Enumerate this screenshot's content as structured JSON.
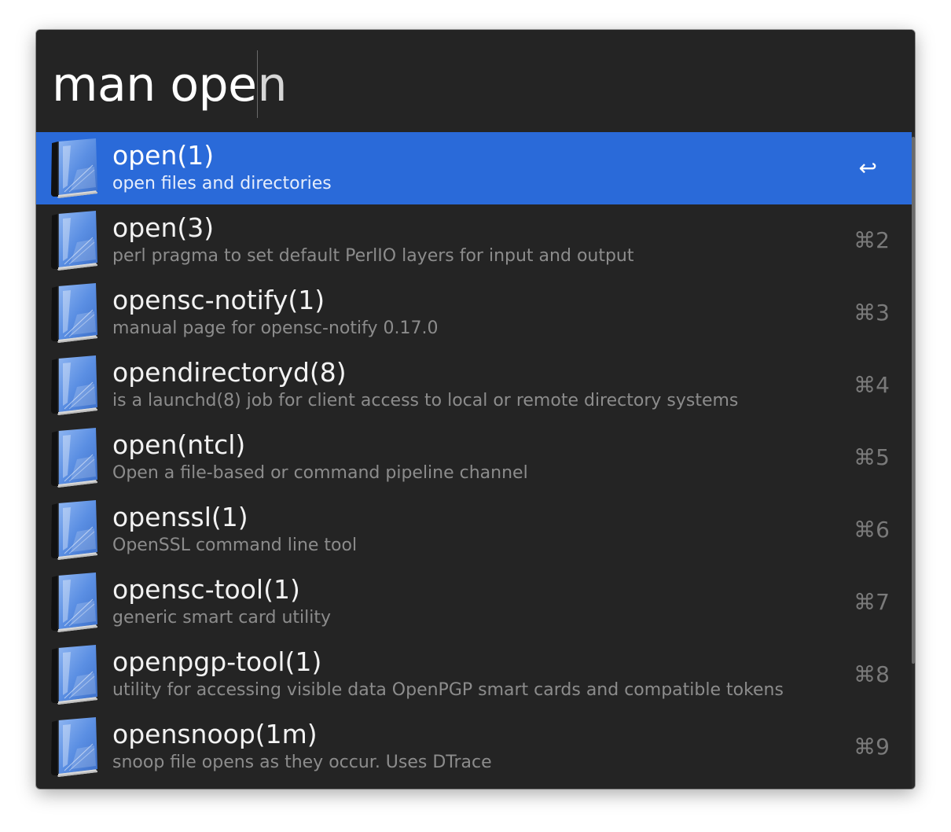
{
  "search": {
    "typed": "man ope",
    "completion": "n"
  },
  "results": [
    {
      "title": "open(1)",
      "subtitle": "open files and directories",
      "shortcut": "↩",
      "icon": "book-icon",
      "selected": true
    },
    {
      "title": "open(3)",
      "subtitle": "perl pragma to set default PerlIO layers for input and output",
      "shortcut": "⌘2",
      "icon": "book-icon"
    },
    {
      "title": "opensc-notify(1)",
      "subtitle": "manual page for opensc-notify 0.17.0",
      "shortcut": "⌘3",
      "icon": "book-icon"
    },
    {
      "title": "opendirectoryd(8)",
      "subtitle": "is a launchd(8) job for client access to local or remote directory systems",
      "shortcut": "⌘4",
      "icon": "book-icon"
    },
    {
      "title": "open(ntcl)",
      "subtitle": "Open a file-based or command pipeline channel",
      "shortcut": "⌘5",
      "icon": "book-icon"
    },
    {
      "title": "openssl(1)",
      "subtitle": "OpenSSL command line tool",
      "shortcut": "⌘6",
      "icon": "book-icon"
    },
    {
      "title": "opensc-tool(1)",
      "subtitle": "generic smart card utility",
      "shortcut": "⌘7",
      "icon": "book-icon"
    },
    {
      "title": "openpgp-tool(1)",
      "subtitle": "utility for accessing visible data OpenPGP smart cards and compatible tokens",
      "shortcut": "⌘8",
      "icon": "book-icon"
    },
    {
      "title": "opensnoop(1m)",
      "subtitle": "snoop file opens as they occur. Uses DTrace",
      "shortcut": "⌘9",
      "icon": "book-icon"
    }
  ],
  "colors": {
    "selected": "#2a6ad9",
    "background": "#242424"
  }
}
